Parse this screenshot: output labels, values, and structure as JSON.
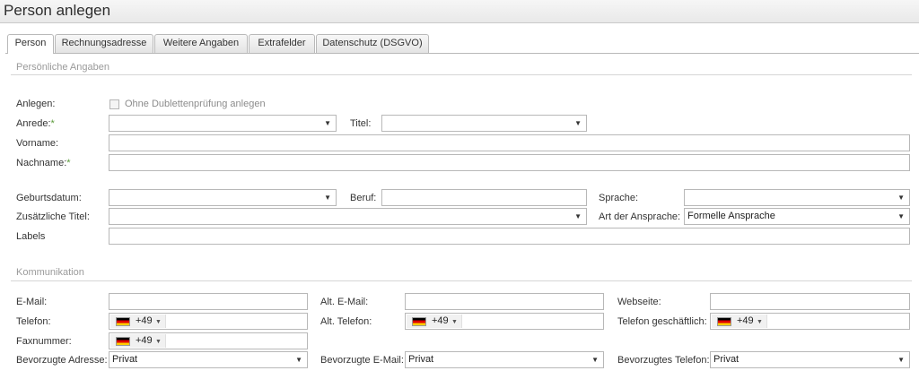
{
  "window": {
    "title": "Person anlegen"
  },
  "tabs": [
    {
      "label": "Person"
    },
    {
      "label": "Rechnungsadresse"
    },
    {
      "label": "Weitere Angaben"
    },
    {
      "label": "Extrafelder"
    },
    {
      "label": "Datenschutz (DSGVO)"
    }
  ],
  "personal": {
    "section_title": "Persönliche Angaben",
    "anlegen_label": "Anlegen:",
    "no_duplicate_check": "Ohne Dublettenprüfung anlegen",
    "anrede_label": "Anrede:",
    "required_mark": "*",
    "titel_label": "Titel:",
    "vorname_label": "Vorname:",
    "nachname_label": "Nachname:",
    "geburtsdatum_label": "Geburtsdatum:",
    "beruf_label": "Beruf:",
    "sprache_label": "Sprache:",
    "zusaetzliche_titel_label": "Zusätzliche Titel:",
    "art_ansprache_label": "Art der Ansprache:",
    "art_ansprache_value": "Formelle Ansprache",
    "labels_label": "Labels"
  },
  "communication": {
    "section_title": "Kommunikation",
    "email_label": "E-Mail:",
    "alt_email_label": "Alt. E-Mail:",
    "webseite_label": "Webseite:",
    "telefon_label": "Telefon:",
    "alt_telefon_label": "Alt. Telefon:",
    "telefon_geschaeftlich_label": "Telefon geschäftlich:",
    "fax_label": "Faxnummer:",
    "phone_prefix": "+49",
    "bevorzugte_adresse_label": "Bevorzugte Adresse:",
    "bevorzugte_adresse_value": "Privat",
    "bevorzugte_email_label": "Bevorzugte E-Mail:",
    "bevorzugte_email_value": "Privat",
    "bevorzugtes_telefon_label": "Bevorzugtes Telefon:",
    "bevorzugtes_telefon_value": "Privat"
  },
  "icons": {
    "dropdown_caret": "▼",
    "flag": "flag-germany-icon"
  }
}
